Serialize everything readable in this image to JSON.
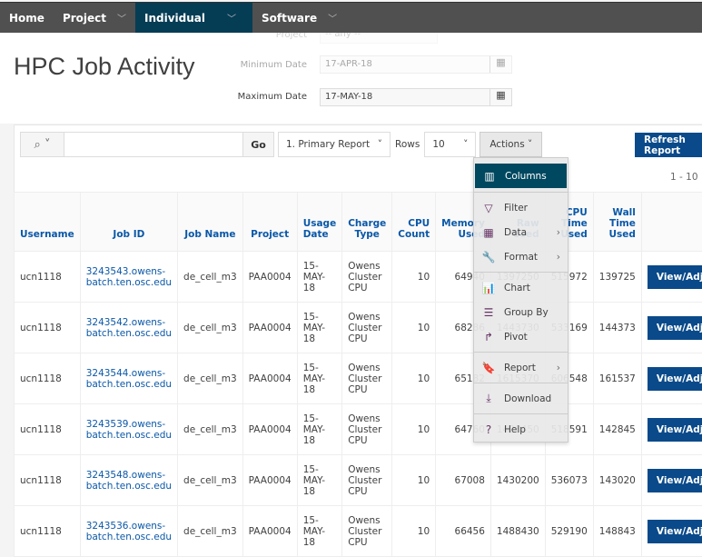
{
  "nav": [
    {
      "label": "Home",
      "dropdown": false
    },
    {
      "label": "Project",
      "dropdown": true
    },
    {
      "label": "Individual",
      "dropdown": true,
      "active": true
    },
    {
      "label": "Software",
      "dropdown": true
    }
  ],
  "page_title": "HPC Job Activity",
  "filters": {
    "project_label": "Project",
    "project_value": "-- any --",
    "min_date_label": "Minimum Date",
    "min_date_value": "17-APR-18",
    "max_date_label": "Maximum Date",
    "max_date_value": "17-MAY-18"
  },
  "toolbar": {
    "search_value": "",
    "go_label": "Go",
    "report_select": "1. Primary Report",
    "rows_label": "Rows",
    "rows_value": "10",
    "actions_label": "Actions",
    "refresh_label": "Refresh Report"
  },
  "pagination": "1 - 10",
  "columns": [
    "Username",
    "Job ID",
    "Job Name",
    "Project",
    "Usage Date",
    "Charge Type",
    "CPU Count",
    "Memory Used",
    "Raw Used",
    "CPU Time Used",
    "Wall Time Used",
    ""
  ],
  "rows": [
    {
      "username": "ucn1118",
      "job_id": "3243543.owens-batch.ten.osc.edu",
      "job_name": "de_cell_m3",
      "project": "PAA0004",
      "date": "15-MAY-18",
      "charge": "Owens Cluster CPU",
      "cpu": "10",
      "mem": "64940",
      "raw": "1397250",
      "cpu_time": "515972",
      "wall": "139725",
      "action": "View/Adjust"
    },
    {
      "username": "ucn1118",
      "job_id": "3243542.owens-batch.ten.osc.edu",
      "job_name": "de_cell_m3",
      "project": "PAA0004",
      "date": "15-MAY-18",
      "charge": "Owens Cluster CPU",
      "cpu": "10",
      "mem": "68286",
      "raw": "1443730",
      "cpu_time": "533169",
      "wall": "144373",
      "action": "View/Adjust"
    },
    {
      "username": "ucn1118",
      "job_id": "3243544.owens-batch.ten.osc.edu",
      "job_name": "de_cell_m3",
      "project": "PAA0004",
      "date": "15-MAY-18",
      "charge": "Owens Cluster CPU",
      "cpu": "10",
      "mem": "65182",
      "raw": "1615370",
      "cpu_time": "606548",
      "wall": "161537",
      "action": "View/Adjust"
    },
    {
      "username": "ucn1118",
      "job_id": "3243539.owens-batch.ten.osc.edu",
      "job_name": "de_cell_m3",
      "project": "PAA0004",
      "date": "15-MAY-18",
      "charge": "Owens Cluster CPU",
      "cpu": "10",
      "mem": "64760",
      "raw": "1428450",
      "cpu_time": "518591",
      "wall": "142845",
      "action": "View/Adjust"
    },
    {
      "username": "ucn1118",
      "job_id": "3243548.owens-batch.ten.osc.edu",
      "job_name": "de_cell_m3",
      "project": "PAA0004",
      "date": "15-MAY-18",
      "charge": "Owens Cluster CPU",
      "cpu": "10",
      "mem": "67008",
      "raw": "1430200",
      "cpu_time": "536073",
      "wall": "143020",
      "action": "View/Adjust"
    },
    {
      "username": "ucn1118",
      "job_id": "3243536.owens-batch.ten.osc.edu",
      "job_name": "de_cell_m3",
      "project": "PAA0004",
      "date": "15-MAY-18",
      "charge": "Owens Cluster CPU",
      "cpu": "10",
      "mem": "66456",
      "raw": "1488430",
      "cpu_time": "529190",
      "wall": "148843",
      "action": "View/Adjust"
    }
  ],
  "actions_menu": [
    {
      "label": "Columns",
      "icon": "columns-icon",
      "glyph": "▥",
      "highlighted": true
    },
    {
      "label": "Filter",
      "icon": "filter-icon",
      "glyph": "▽"
    },
    {
      "label": "Data",
      "icon": "data-icon",
      "glyph": "▦",
      "submenu": true
    },
    {
      "label": "Format",
      "icon": "wrench-icon",
      "glyph": "🔧",
      "submenu": true,
      "sep_after": true
    },
    {
      "label": "Chart",
      "icon": "chart-icon",
      "glyph": "📊"
    },
    {
      "label": "Group By",
      "icon": "group-by-icon",
      "glyph": "☰"
    },
    {
      "label": "Pivot",
      "icon": "pivot-icon",
      "glyph": "↱",
      "sep_after": true
    },
    {
      "label": "Report",
      "icon": "bookmark-icon",
      "glyph": "🔖",
      "submenu": true,
      "sep_after": true
    },
    {
      "label": "Download",
      "icon": "download-icon",
      "glyph": "⤓",
      "sep_after": true
    },
    {
      "label": "Help",
      "icon": "help-icon",
      "glyph": "?"
    }
  ],
  "colors": {
    "nav_bg": "#505050",
    "nav_active": "#053d55",
    "accent_button": "#0a4a8a",
    "menu_highlight": "#00485f",
    "header_text": "#0a58a8"
  }
}
